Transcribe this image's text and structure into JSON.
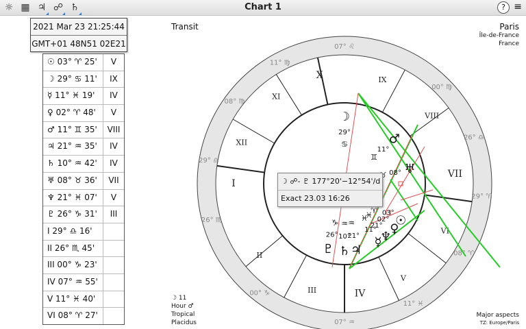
{
  "window": {
    "title": "Chart 1",
    "help_label": "?",
    "menu_label": "≡"
  },
  "toolbar": [
    {
      "name": "wheel-icon",
      "glyph": "☼"
    },
    {
      "name": "grid-icon",
      "glyph": "▦"
    },
    {
      "name": "jupiter-toolbar-icon",
      "glyph": "♃"
    },
    {
      "name": "aspects-toolbar-icon",
      "glyph": "☍"
    },
    {
      "name": "saturn-toolbar-icon",
      "glyph": "♄"
    }
  ],
  "datetime": {
    "date": "2021 Mar 23 21:25:44",
    "zone": "GMT+01  48N51 02E21"
  },
  "positions": [
    {
      "pos": "☉  03° ♈ 25'",
      "house": "V"
    },
    {
      "pos": "☽  29° ♋ 11'",
      "house": "IX"
    },
    {
      "pos": "☿  11° ♓ 19'",
      "house": "IV"
    },
    {
      "pos": "♀  02° ♈ 48'",
      "house": "V"
    },
    {
      "pos": "♂  11° ♊ 35'",
      "house": "VIII"
    },
    {
      "pos": "♃  21° ♒ 35'",
      "house": "IV"
    },
    {
      "pos": "♄  10° ♒ 42'",
      "house": "IV"
    },
    {
      "pos": "♅  08° ♉ 36'",
      "house": "VII"
    },
    {
      "pos": "♆  21° ♓ 07'",
      "house": "V"
    },
    {
      "pos": "♇  26° ♑ 31'",
      "house": "III"
    },
    {
      "pos": "I  29° ♎ 16'",
      "house": ""
    },
    {
      "pos": "II  26° ♏ 45'",
      "house": ""
    },
    {
      "pos": "III  00° ♑ 23'",
      "house": ""
    },
    {
      "pos": "IV  07° ♒ 55'",
      "house": ""
    },
    {
      "pos": "V  11° ♓ 40'",
      "house": ""
    },
    {
      "pos": "VI  08° ♈ 27'",
      "house": ""
    }
  ],
  "labels": {
    "transit": "Transit",
    "city": "Paris",
    "region": "Île-de-France",
    "country": "France",
    "hour_moon": "☽ 11",
    "hour_label": "Hour ♂",
    "zodiac": "Tropical",
    "system": "Placidus",
    "major_aspects": "Major aspects",
    "tz": "TZ: Europe/Paris"
  },
  "tooltip": {
    "line1": "☽ ☍- ♇ 177°20'−12°54'/d",
    "line2": "Exact 23.03 16:26"
  },
  "colors": {
    "red": "#e05050",
    "green": "#22cc22",
    "ring": "#e6e6e6"
  },
  "wheel": {
    "house_numerals": [
      {
        "label": "X",
        "angle": 103
      },
      {
        "label": "IX",
        "angle": 70
      },
      {
        "label": "VIII",
        "angle": 38
      },
      {
        "label": "VII",
        "angle": 5
      },
      {
        "label": "VI",
        "angle": -25
      },
      {
        "label": "V",
        "angle": -58
      },
      {
        "label": "IV",
        "angle": -82
      },
      {
        "label": "III",
        "angle": -107
      },
      {
        "label": "II",
        "angle": -140
      },
      {
        "label": "I",
        "angle": 180
      },
      {
        "label": "XII",
        "angle": 158
      },
      {
        "label": "XI",
        "angle": 128
      }
    ],
    "cusp_degrees": [
      {
        "label": "07° ♌",
        "angle": 90
      },
      {
        "label": "00° ♍",
        "angle": 45
      },
      {
        "label": "26° ♎",
        "angle": 20
      },
      {
        "label": "29° ♈",
        "angle": -5
      },
      {
        "label": "08° ♈",
        "angle": -30
      },
      {
        "label": "11° ♓",
        "angle": -60
      },
      {
        "label": "07° ♒",
        "angle": -90
      },
      {
        "label": "00° ♑",
        "angle": -128
      },
      {
        "label": "26° ♏",
        "angle": -165
      },
      {
        "label": "29° ♎",
        "angle": 170
      },
      {
        "label": "08° ♍",
        "angle": 143
      },
      {
        "label": "11° ♍",
        "angle": 118
      }
    ],
    "planets": [
      {
        "glyph": "☽",
        "deg": "29°",
        "sign": "♋",
        "angle": 90
      },
      {
        "glyph": "♂",
        "deg": "11°",
        "sign": "♊",
        "angle": 42
      },
      {
        "glyph": "♅",
        "deg": "08°",
        "sign": "♉",
        "angle": 13
      },
      {
        "glyph": "☉",
        "deg": "03°",
        "sign": "♈",
        "angle": -33
      },
      {
        "glyph": "♀",
        "deg": "02°",
        "sign": "♈",
        "angle": -42
      },
      {
        "glyph": "♆",
        "deg": "21°",
        "sign": "♓",
        "angle": -52
      },
      {
        "glyph": "☿",
        "deg": "11°",
        "sign": "♓",
        "angle": -60
      },
      {
        "glyph": "♃",
        "deg": "21°",
        "sign": "♒",
        "angle": -80
      },
      {
        "glyph": "♄",
        "deg": "10°",
        "sign": "♒",
        "angle": -90
      },
      {
        "glyph": "♇",
        "deg": "26°",
        "sign": "♑",
        "angle": -104
      }
    ]
  }
}
